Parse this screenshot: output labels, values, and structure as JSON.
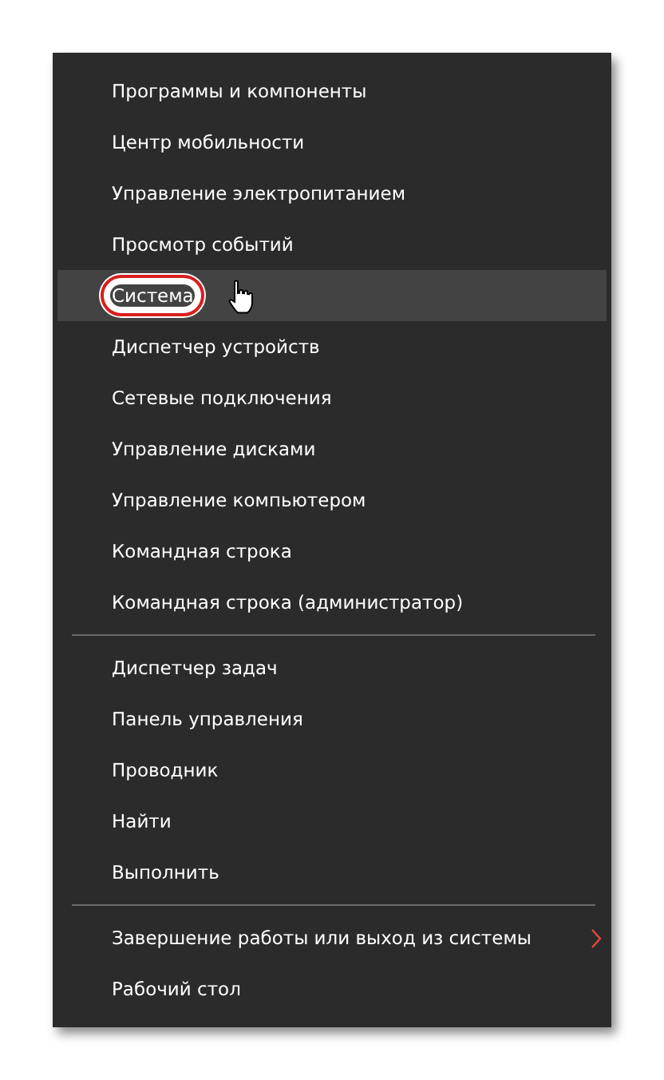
{
  "menu": {
    "groups": [
      {
        "items": [
          {
            "label": "Программы и компоненты",
            "kind": "command",
            "selected": false,
            "circled": false
          },
          {
            "label": "Центр мобильности",
            "kind": "command",
            "selected": false,
            "circled": false
          },
          {
            "label": "Управление электропитанием",
            "kind": "command",
            "selected": false,
            "circled": false
          },
          {
            "label": "Просмотр событий",
            "kind": "command",
            "selected": false,
            "circled": false
          },
          {
            "label": "Система",
            "kind": "command",
            "selected": true,
            "circled": true
          },
          {
            "label": "Диспетчер устройств",
            "kind": "command",
            "selected": false,
            "circled": false
          },
          {
            "label": "Сетевые подключения",
            "kind": "command",
            "selected": false,
            "circled": false
          },
          {
            "label": "Управление дисками",
            "kind": "command",
            "selected": false,
            "circled": false
          },
          {
            "label": "Управление компьютером",
            "kind": "command",
            "selected": false,
            "circled": false
          },
          {
            "label": "Командная строка",
            "kind": "command",
            "selected": false,
            "circled": false
          },
          {
            "label": "Командная строка (администратор)",
            "kind": "command",
            "selected": false,
            "circled": false
          }
        ]
      },
      {
        "items": [
          {
            "label": "Диспетчер задач",
            "kind": "command",
            "selected": false,
            "circled": false
          },
          {
            "label": "Панель управления",
            "kind": "command",
            "selected": false,
            "circled": false
          },
          {
            "label": "Проводник",
            "kind": "command",
            "selected": false,
            "circled": false
          },
          {
            "label": "Найти",
            "kind": "command",
            "selected": false,
            "circled": false
          },
          {
            "label": "Выполнить",
            "kind": "command",
            "selected": false,
            "circled": false
          }
        ]
      },
      {
        "items": [
          {
            "label": "Завершение работы или выход из системы",
            "kind": "submenu",
            "selected": false,
            "circled": false
          },
          {
            "label": "Рабочий стол",
            "kind": "command",
            "selected": false,
            "circled": false
          }
        ]
      }
    ]
  }
}
